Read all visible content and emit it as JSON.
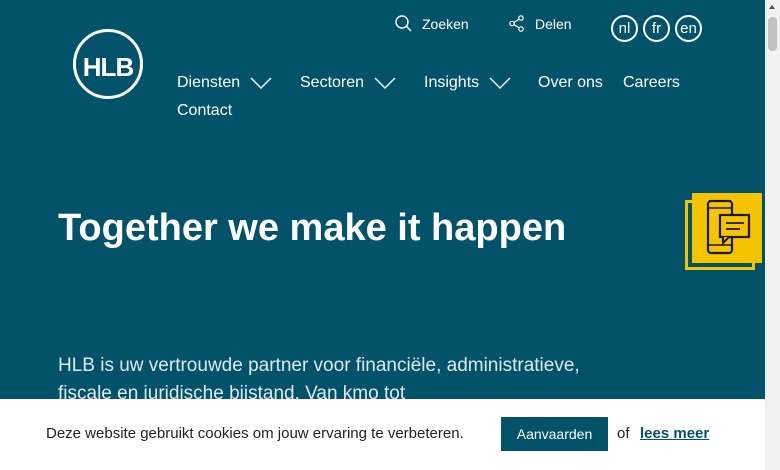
{
  "header": {
    "logo_text": "HLB",
    "search_label": "Zoeken",
    "share_label": "Delen",
    "languages": [
      "nl",
      "fr",
      "en"
    ]
  },
  "nav": {
    "items": [
      {
        "label": "Diensten",
        "dropdown": true
      },
      {
        "label": "Sectoren",
        "dropdown": true
      },
      {
        "label": "Insights",
        "dropdown": true
      },
      {
        "label": "Over ons",
        "dropdown": false
      },
      {
        "label": "Careers",
        "dropdown": false
      },
      {
        "label": "Contact",
        "dropdown": false
      }
    ]
  },
  "hero": {
    "title": "Together we make it happen",
    "text": "HLB is uw vertrouwde partner voor financiële, administratieve, fiscale en juridische bijstand. Van kmo tot"
  },
  "contact_widget": {
    "icon": "phone-chat-icon"
  },
  "cookie": {
    "text": "Deze website gebruikt cookies om jouw ervaring te verbeteren.",
    "accept_label": "Aanvaarden",
    "of_label": "of",
    "more_label": "lees meer"
  },
  "colors": {
    "brand": "#02536a",
    "accent": "#f5c300",
    "cookie_bg": "#ffffff"
  }
}
